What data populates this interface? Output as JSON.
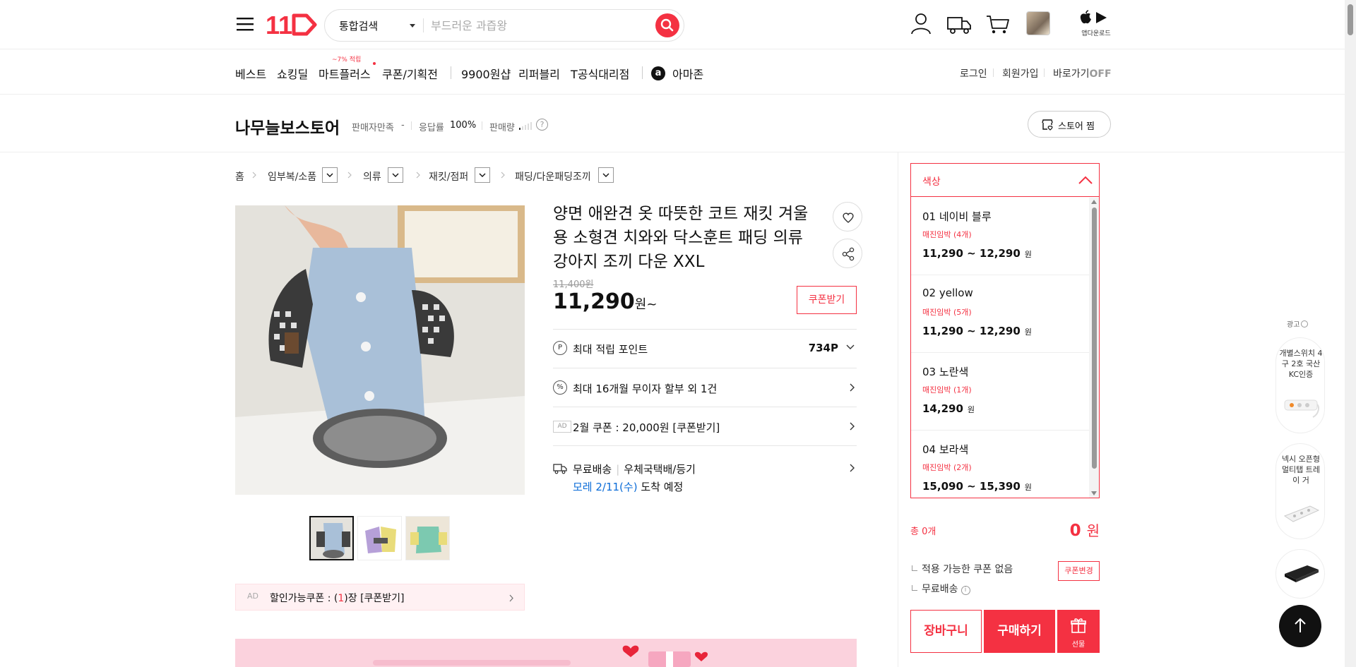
{
  "header": {
    "logo_text": "11",
    "search": {
      "category": "통합검색",
      "placeholder": "부드러운 과즙왕"
    },
    "app_download_label": "앱다운로드"
  },
  "gnb": {
    "items": [
      "베스트",
      "쇼킹딜",
      "마트플러스",
      "쿠폰/기획전",
      "9900원샵",
      "리퍼블리",
      "T공식대리점",
      "아마존"
    ],
    "mart_badge": "~7% 적립",
    "amazon_icon": "a",
    "utils": [
      "로그인",
      "회원가입",
      "바로가기"
    ],
    "shortcut_state": "OFF"
  },
  "store": {
    "name": "나무늘보스토어",
    "satisfaction_label": "판매자만족",
    "satisfaction_value": "-",
    "response_label": "응답률",
    "response_value": "100%",
    "sales_label": "판매량",
    "help_icon": "?",
    "zzim_label": "스토어 찜"
  },
  "breadcrumb": [
    "홈",
    "임부복/소품",
    "의류",
    "재킷/점퍼",
    "패딩/다운패딩조끼"
  ],
  "product": {
    "title": "양면 애완견 옷 따뜻한 코트 재킷 겨울용 소형견 치와와 닥스훈트 패딩 의류 강아지 조끼 다운 XXL",
    "original_price": "11,400원",
    "sale_price": "11,290",
    "price_suffix": "원~",
    "coupon_btn": "쿠폰받기",
    "points_icon": "P",
    "points_label": "최대 적립 포인트",
    "points_value": "734P",
    "installment_icon": "%",
    "installment_label": "최대 16개월 무이자 할부 외 1건",
    "ad_tag": "AD",
    "ad_coupon_label": "2월 쿠폰 : 20,000원 [쿠폰받기]",
    "shipping_label": "무료배송",
    "shipping_method": "우체국택배/등기",
    "shipping_eta_date": "모레 2/11(수)",
    "shipping_eta_suffix": " 도착 예정"
  },
  "gallery": {
    "ad_tag": "AD",
    "coupon_prefix": "할인가능쿠폰 : (",
    "coupon_count": "1",
    "coupon_suffix": ")장 [쿠폰받기]"
  },
  "options": {
    "header": "색상",
    "items": [
      {
        "name": "01 네이비 블루",
        "stock": "매진임박 (4개)",
        "price": "11,290 ~ 12,290",
        "unit": "원"
      },
      {
        "name": "02 yellow",
        "stock": "매진임박 (5개)",
        "price": "11,290 ~ 12,290",
        "unit": "원"
      },
      {
        "name": "03 노란색",
        "stock": "매진임박 (1개)",
        "price": "14,290",
        "unit": "원"
      },
      {
        "name": "04 보라색",
        "stock": "매진임박 (2개)",
        "price": "15,090 ~ 15,390",
        "unit": "원"
      }
    ]
  },
  "order": {
    "total_label": "총 0개",
    "total_value": "0",
    "total_unit": "원",
    "coupon_none": "적용 가능한 쿠폰 없음",
    "coupon_change": "쿠폰변경",
    "free_shipping": "무료배송",
    "info_icon": "i",
    "cart_btn": "장바구니",
    "buy_btn": "구매하기",
    "gift_btn": "선물"
  },
  "ads": {
    "label": "광고",
    "cards": [
      {
        "text": "개별스위치 4구 2호 국산 KC인증"
      },
      {
        "text": "넥시 오픈형 멀티탭 트레이 거"
      }
    ]
  },
  "colors": {
    "accent": "#f43142",
    "link_blue": "#0b6cd8",
    "banner_pink": "#fbd2dd"
  }
}
